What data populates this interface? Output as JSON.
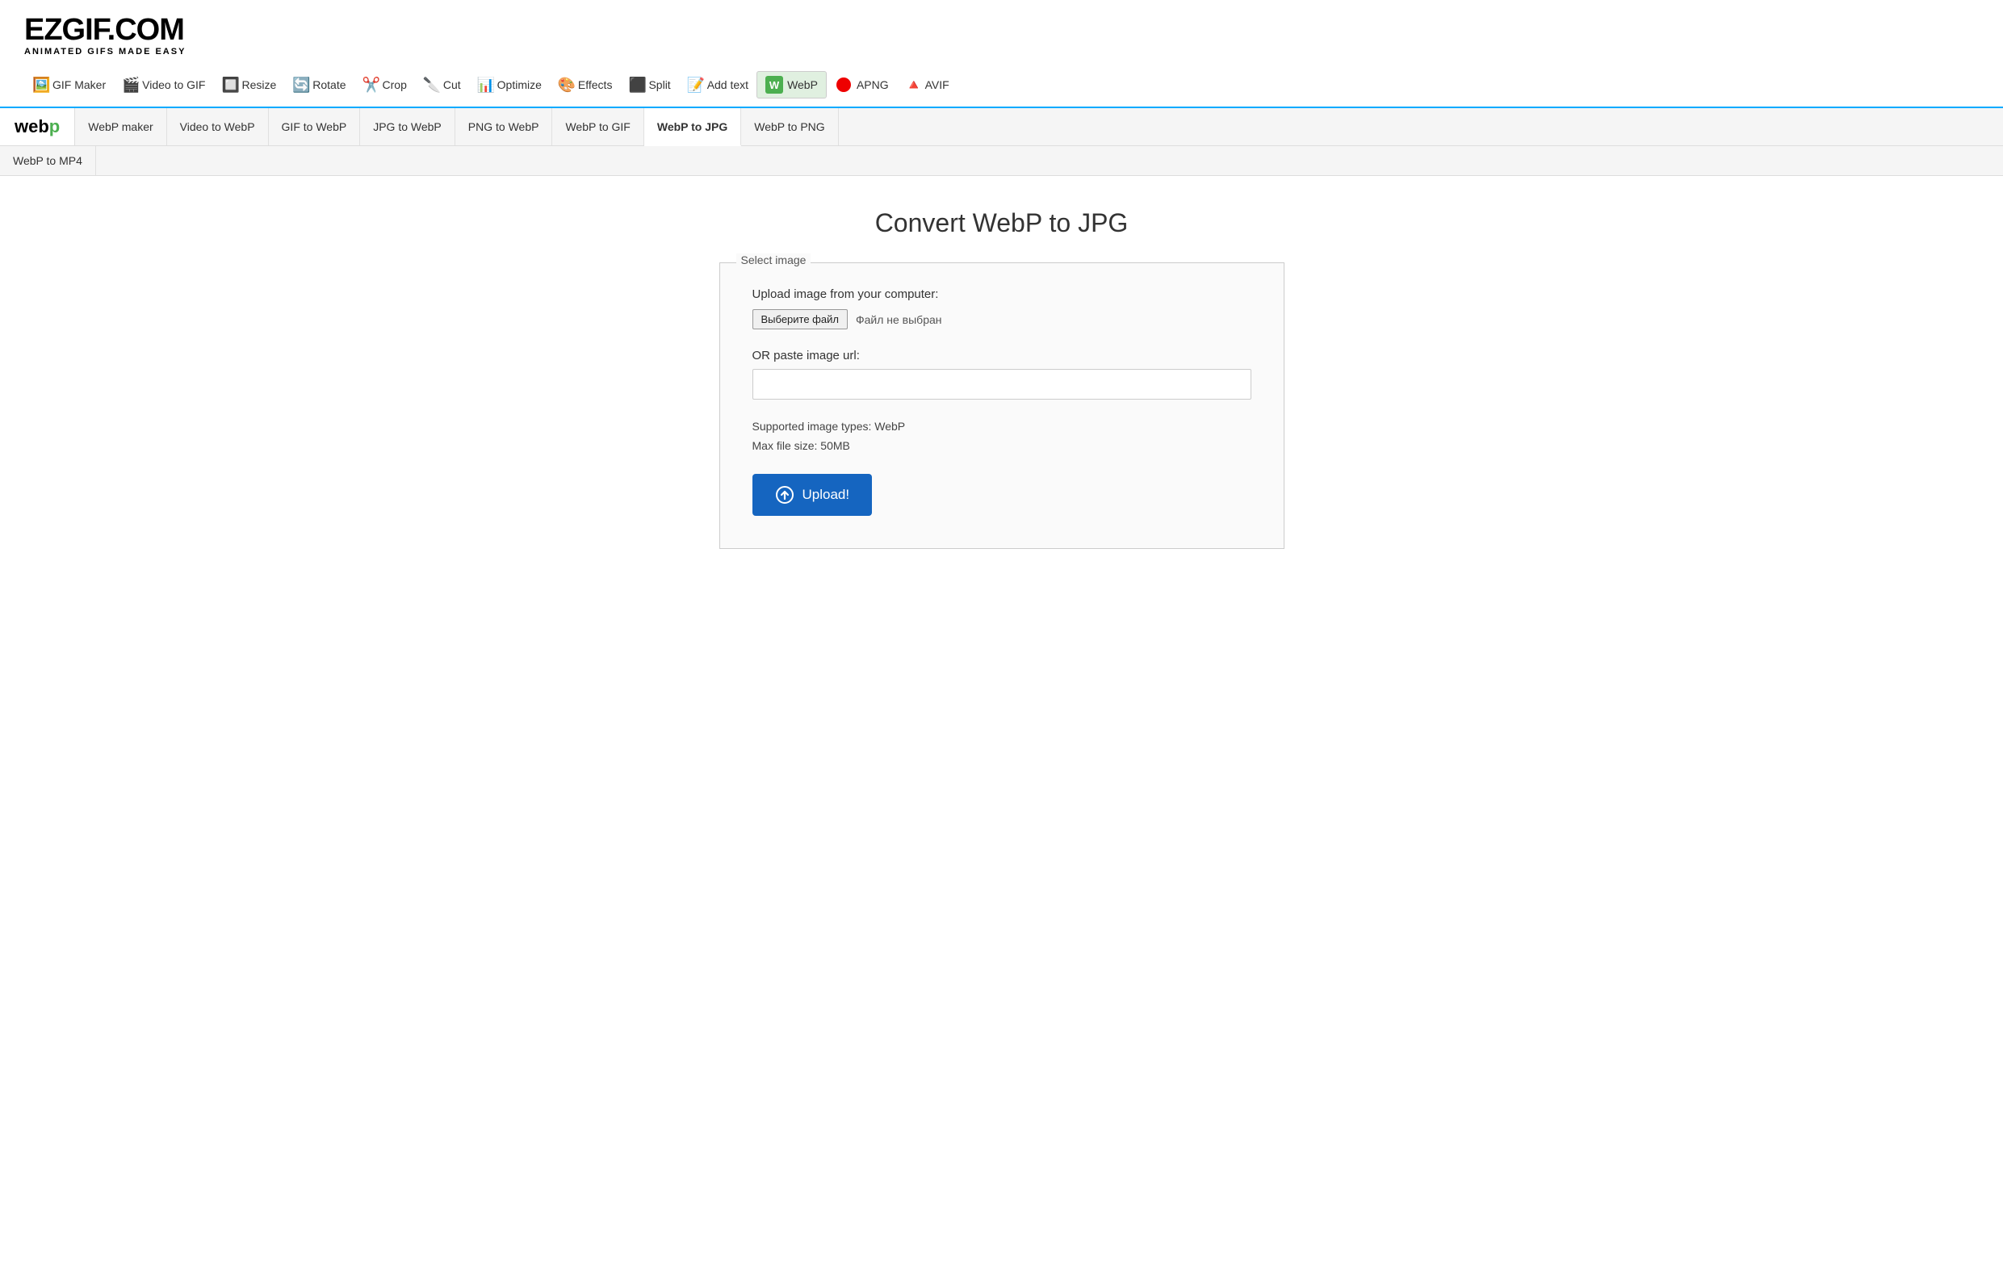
{
  "logo": {
    "main": "EZGIF.COM",
    "sub": "ANIMATED GIFS MADE EASY"
  },
  "topNav": {
    "items": [
      {
        "id": "gif-maker",
        "label": "GIF Maker",
        "icon": "🖼"
      },
      {
        "id": "video-to-gif",
        "label": "Video to GIF",
        "icon": "🎬"
      },
      {
        "id": "resize",
        "label": "Resize",
        "icon": "🔲"
      },
      {
        "id": "rotate",
        "label": "Rotate",
        "icon": "🔄"
      },
      {
        "id": "crop",
        "label": "Crop",
        "icon": "✂"
      },
      {
        "id": "cut",
        "label": "Cut",
        "icon": "🔪"
      },
      {
        "id": "optimize",
        "label": "Optimize",
        "icon": "📊"
      },
      {
        "id": "effects",
        "label": "Effects",
        "icon": "🎨"
      },
      {
        "id": "split",
        "label": "Split",
        "icon": "⬛"
      },
      {
        "id": "add-text",
        "label": "Add text",
        "icon": "📝"
      },
      {
        "id": "webp",
        "label": "WebP",
        "icon": "🟩",
        "active": true
      },
      {
        "id": "apng",
        "label": "APNG",
        "icon": "🔴"
      },
      {
        "id": "avif",
        "label": "AVIF",
        "icon": "🔺"
      }
    ]
  },
  "subNav": {
    "logoText": "web",
    "logoP": "p",
    "tabs": [
      {
        "id": "webp-maker",
        "label": "WebP maker"
      },
      {
        "id": "video-to-webp",
        "label": "Video to WebP"
      },
      {
        "id": "gif-to-webp",
        "label": "GIF to WebP"
      },
      {
        "id": "jpg-to-webp",
        "label": "JPG to WebP"
      },
      {
        "id": "png-to-webp",
        "label": "PNG to WebP"
      },
      {
        "id": "webp-to-gif",
        "label": "WebP to GIF"
      },
      {
        "id": "webp-to-jpg",
        "label": "WebP to JPG",
        "active": true
      },
      {
        "id": "webp-to-png",
        "label": "WebP to PNG"
      }
    ],
    "tabs2": [
      {
        "id": "webp-to-mp4",
        "label": "WebP to MP4"
      }
    ]
  },
  "main": {
    "pageTitle": "Convert WebP to JPG",
    "card": {
      "legend": "Select image",
      "uploadLabel": "Upload image from your computer:",
      "chooseFileBtn": "Выберите файл",
      "noFileText": "Файл не выбран",
      "orPasteLabel": "OR paste image url:",
      "urlPlaceholder": "",
      "supportedTypes": "Supported image types: WebP",
      "maxFileSize": "Max file size: 50MB",
      "uploadBtnLabel": "Upload!"
    }
  }
}
